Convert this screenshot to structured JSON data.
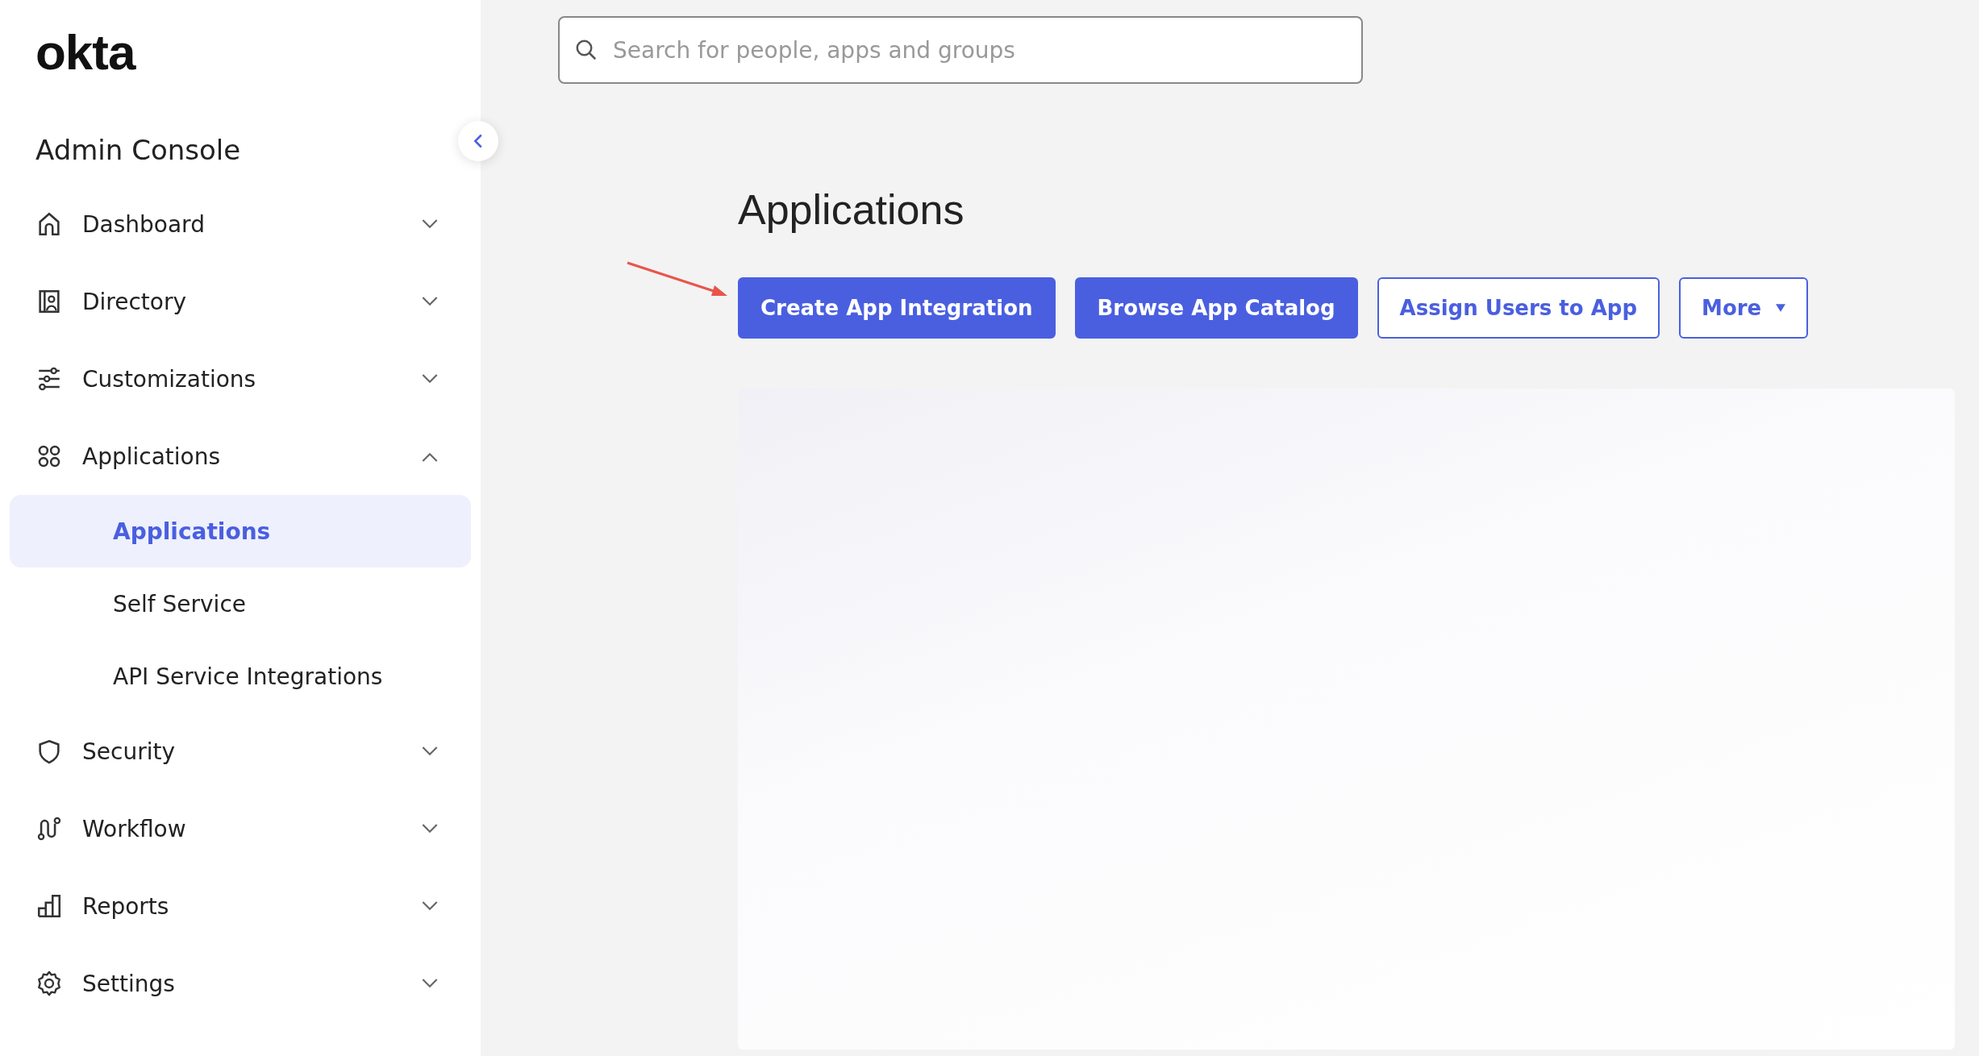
{
  "logo": "okta",
  "console_title": "Admin Console",
  "nav": [
    {
      "label": "Dashboard",
      "expanded": false
    },
    {
      "label": "Directory",
      "expanded": false
    },
    {
      "label": "Customizations",
      "expanded": false
    },
    {
      "label": "Applications",
      "expanded": true,
      "children": [
        {
          "label": "Applications",
          "selected": true
        },
        {
          "label": "Self Service",
          "selected": false
        },
        {
          "label": "API Service Integrations",
          "selected": false
        }
      ]
    },
    {
      "label": "Security",
      "expanded": false
    },
    {
      "label": "Workflow",
      "expanded": false
    },
    {
      "label": "Reports",
      "expanded": false
    },
    {
      "label": "Settings",
      "expanded": false
    }
  ],
  "search": {
    "placeholder": "Search for people, apps and groups"
  },
  "page_title": "Applications",
  "actions": [
    {
      "label": "Create App Integration",
      "kind": "primary"
    },
    {
      "label": "Browse App Catalog",
      "kind": "primary"
    },
    {
      "label": "Assign Users to App",
      "kind": "secondary"
    },
    {
      "label": "More",
      "kind": "dropdown"
    }
  ]
}
